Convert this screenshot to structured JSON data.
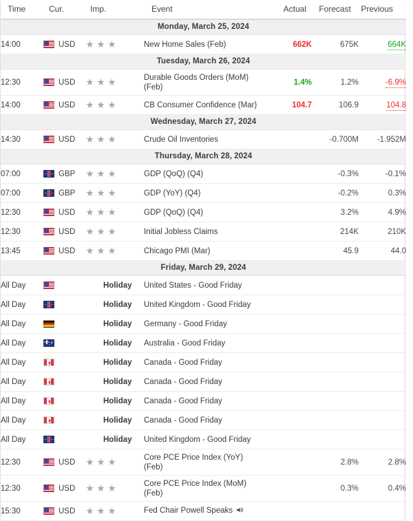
{
  "header": {
    "time": "Time",
    "currency": "Cur.",
    "importance": "Imp.",
    "event": "Event",
    "actual": "Actual",
    "forecast": "Forecast",
    "previous": "Previous"
  },
  "colors": {
    "positive": "#1aa81a",
    "negative": "#f52b2b",
    "neutral": "#4a4a4a",
    "date_band": "#f0f0f0",
    "star": "#a9a9a9"
  },
  "holiday_label": "Holiday",
  "sections": [
    {
      "date": "Monday, March 25, 2024",
      "rows": [
        {
          "time": "14:00",
          "currency": "USD",
          "flag": "us-flag-icon",
          "stars": 3,
          "event": "New Home Sales (Feb)",
          "tall": false,
          "actual": "662K",
          "actual_state": "down",
          "forecast": "675K",
          "previous": "664K",
          "previous_state": "up",
          "speaker": false
        }
      ]
    },
    {
      "date": "Tuesday, March 26, 2024",
      "rows": [
        {
          "time": "12:30",
          "currency": "USD",
          "flag": "us-flag-icon",
          "stars": 3,
          "event": "Durable Goods Orders (MoM) (Feb)",
          "tall": true,
          "actual": "1.4%",
          "actual_state": "up",
          "forecast": "1.2%",
          "previous": "-6.9%",
          "previous_state": "down",
          "speaker": false
        },
        {
          "time": "14:00",
          "currency": "USD",
          "flag": "us-flag-icon",
          "stars": 3,
          "event": "CB Consumer Confidence (Mar)",
          "tall": false,
          "actual": "104.7",
          "actual_state": "down",
          "forecast": "106.9",
          "previous": "104.8",
          "previous_state": "down",
          "speaker": false
        }
      ]
    },
    {
      "date": "Wednesday, March 27, 2024",
      "rows": [
        {
          "time": "14:30",
          "currency": "USD",
          "flag": "us-flag-icon",
          "stars": 3,
          "event": "Crude Oil Inventories",
          "tall": false,
          "actual": "",
          "actual_state": "neutral",
          "forecast": "-0.700M",
          "previous": "-1.952M",
          "previous_state": "neutral",
          "speaker": false
        }
      ]
    },
    {
      "date": "Thursday, March 28, 2024",
      "rows": [
        {
          "time": "07:00",
          "currency": "GBP",
          "flag": "uk-flag-icon",
          "stars": 3,
          "event": "GDP (QoQ) (Q4)",
          "tall": false,
          "actual": "",
          "actual_state": "neutral",
          "forecast": "-0.3%",
          "previous": "-0.1%",
          "previous_state": "neutral",
          "speaker": false
        },
        {
          "time": "07:00",
          "currency": "GBP",
          "flag": "uk-flag-icon",
          "stars": 3,
          "event": "GDP (YoY) (Q4)",
          "tall": false,
          "actual": "",
          "actual_state": "neutral",
          "forecast": "-0.2%",
          "previous": "0.3%",
          "previous_state": "neutral",
          "speaker": false
        },
        {
          "time": "12:30",
          "currency": "USD",
          "flag": "us-flag-icon",
          "stars": 3,
          "event": "GDP (QoQ) (Q4)",
          "tall": false,
          "actual": "",
          "actual_state": "neutral",
          "forecast": "3.2%",
          "previous": "4.9%",
          "previous_state": "neutral",
          "speaker": false
        },
        {
          "time": "12:30",
          "currency": "USD",
          "flag": "us-flag-icon",
          "stars": 3,
          "event": "Initial Jobless Claims",
          "tall": false,
          "actual": "",
          "actual_state": "neutral",
          "forecast": "214K",
          "previous": "210K",
          "previous_state": "neutral",
          "speaker": false
        },
        {
          "time": "13:45",
          "currency": "USD",
          "flag": "us-flag-icon",
          "stars": 3,
          "event": "Chicago PMI (Mar)",
          "tall": false,
          "actual": "",
          "actual_state": "neutral",
          "forecast": "45.9",
          "previous": "44.0",
          "previous_state": "neutral",
          "speaker": false
        }
      ]
    },
    {
      "date": "Friday, March 29, 2024",
      "rows": [
        {
          "time": "All Day",
          "currency": "",
          "flag": "us-flag-icon",
          "holiday": true,
          "event": "United States - Good Friday",
          "tall": false,
          "actual": "",
          "actual_state": "neutral",
          "forecast": "",
          "previous": "",
          "previous_state": "neutral",
          "speaker": false
        },
        {
          "time": "All Day",
          "currency": "",
          "flag": "uk-flag-icon",
          "holiday": true,
          "event": "United Kingdom - Good Friday",
          "tall": false,
          "actual": "",
          "actual_state": "neutral",
          "forecast": "",
          "previous": "",
          "previous_state": "neutral",
          "speaker": false
        },
        {
          "time": "All Day",
          "currency": "",
          "flag": "de-flag-icon",
          "holiday": true,
          "event": "Germany - Good Friday",
          "tall": false,
          "actual": "",
          "actual_state": "neutral",
          "forecast": "",
          "previous": "",
          "previous_state": "neutral",
          "speaker": false
        },
        {
          "time": "All Day",
          "currency": "",
          "flag": "au-flag-icon",
          "holiday": true,
          "event": "Australia - Good Friday",
          "tall": false,
          "actual": "",
          "actual_state": "neutral",
          "forecast": "",
          "previous": "",
          "previous_state": "neutral",
          "speaker": false
        },
        {
          "time": "All Day",
          "currency": "",
          "flag": "ca-flag-icon",
          "holiday": true,
          "event": "Canada - Good Friday",
          "tall": false,
          "actual": "",
          "actual_state": "neutral",
          "forecast": "",
          "previous": "",
          "previous_state": "neutral",
          "speaker": false
        },
        {
          "time": "All Day",
          "currency": "",
          "flag": "ca-flag-icon",
          "holiday": true,
          "event": "Canada - Good Friday",
          "tall": false,
          "actual": "",
          "actual_state": "neutral",
          "forecast": "",
          "previous": "",
          "previous_state": "neutral",
          "speaker": false
        },
        {
          "time": "All Day",
          "currency": "",
          "flag": "ca-flag-icon",
          "holiday": true,
          "event": "Canada - Good Friday",
          "tall": false,
          "actual": "",
          "actual_state": "neutral",
          "forecast": "",
          "previous": "",
          "previous_state": "neutral",
          "speaker": false
        },
        {
          "time": "All Day",
          "currency": "",
          "flag": "ca-flag-icon",
          "holiday": true,
          "event": "Canada - Good Friday",
          "tall": false,
          "actual": "",
          "actual_state": "neutral",
          "forecast": "",
          "previous": "",
          "previous_state": "neutral",
          "speaker": false
        },
        {
          "time": "All Day",
          "currency": "",
          "flag": "uk-flag-icon",
          "holiday": true,
          "event": "United Kingdom - Good Friday",
          "tall": false,
          "actual": "",
          "actual_state": "neutral",
          "forecast": "",
          "previous": "",
          "previous_state": "neutral",
          "speaker": false
        },
        {
          "time": "12:30",
          "currency": "USD",
          "flag": "us-flag-icon",
          "stars": 3,
          "event": "Core PCE Price Index (YoY) (Feb)",
          "tall": true,
          "actual": "",
          "actual_state": "neutral",
          "forecast": "2.8%",
          "previous": "2.8%",
          "previous_state": "neutral",
          "speaker": false
        },
        {
          "time": "12:30",
          "currency": "USD",
          "flag": "us-flag-icon",
          "stars": 3,
          "event": "Core PCE Price Index (MoM) (Feb)",
          "tall": true,
          "actual": "",
          "actual_state": "neutral",
          "forecast": "0.3%",
          "previous": "0.4%",
          "previous_state": "neutral",
          "speaker": false
        },
        {
          "time": "15:30",
          "currency": "USD",
          "flag": "us-flag-icon",
          "stars": 3,
          "event": "Fed Chair Powell Speaks",
          "tall": false,
          "actual": "",
          "actual_state": "neutral",
          "forecast": "",
          "previous": "",
          "previous_state": "neutral",
          "speaker": true
        }
      ]
    }
  ]
}
